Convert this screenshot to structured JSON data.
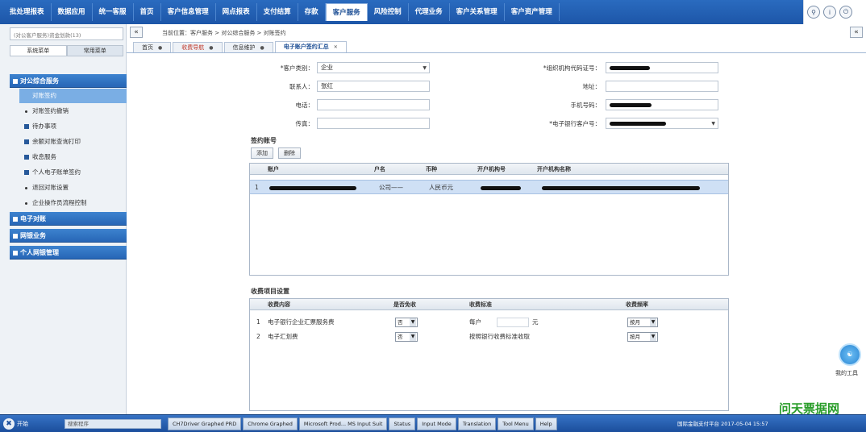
{
  "topnav": {
    "items": [
      "批处理报表",
      "数据应用",
      "统一客服",
      "首页",
      "客户信息管理",
      "网点报表",
      "支付结算",
      "存款",
      "客户服务",
      "风险控制",
      "代理业务",
      "客户关系管理",
      "客户资产管理"
    ],
    "active_index": 8
  },
  "sidebar": {
    "search_placeholder": "(对公客户服务)资金划款(13)",
    "tabs": [
      "系统菜单",
      "常用菜单"
    ],
    "groups": [
      "对公综合服务",
      "电子对账",
      "网银业务",
      "个人网银管理"
    ],
    "items": [
      "对账签约",
      "对账签约撤销",
      "待办事项",
      "余额对账查询打印",
      "收息服务",
      "个人电子账单签约",
      "退回对账设置",
      "企业操作员流程控制"
    ]
  },
  "main": {
    "collapse_label": "«",
    "expand_label": "«",
    "breadcrumb": "当前位置：客户服务 > 对公综合服务 > 对账签约",
    "tabs": [
      "首页",
      "收费导航",
      "信息维护",
      "电子账户签约汇总"
    ],
    "form": {
      "customer_type_label": "*客户类别：",
      "customer_type_value": "企业",
      "contact_label": "联系人：",
      "contact_value": "张红",
      "phone_label": "电话：",
      "fax_label": "传真：",
      "org_code_label": "*组织机构代码证号：",
      "address_label": "地址：",
      "mobile_label": "手机号码：",
      "bank_no_label": "*电子银行客户号："
    },
    "accounts": {
      "title": "签约账号",
      "add_label": "添加",
      "delete_label": "删除",
      "headers": [
        "账户",
        "户名",
        "币种",
        "开户机构号",
        "开户机构名称"
      ],
      "rows": [
        {
          "no": "1",
          "name": "公司——",
          "currency": "人民币元"
        }
      ]
    },
    "fees": {
      "title": "收费项目设置",
      "headers": [
        "收费内容",
        "是否免收",
        "收费标准",
        "收费频率"
      ],
      "rows": [
        {
          "no": "1",
          "content": "电子银行企业汇票服务费",
          "free": "否",
          "standard": "每户",
          "unit": "元",
          "freq": "按月"
        },
        {
          "no": "2",
          "content": "电子汇划费",
          "free": "否",
          "standard": "按照银行收费标准收取",
          "unit": "",
          "freq": "按月"
        }
      ]
    }
  },
  "float_button": {
    "label": "我的工具"
  },
  "watermark": "问天票据网",
  "taskbar": {
    "start_label": "开始",
    "search_placeholder": "搜索程序",
    "apps": [
      "CH7Driver Graphed PRD",
      "Chrome Graphed",
      "Microsoft Prod... MS Input Suit",
      "Status",
      "Input Mode",
      "Translation",
      "Tool Menu",
      "Help"
    ],
    "tray": "国际金融支付平台    2017-05-04 15:57"
  }
}
